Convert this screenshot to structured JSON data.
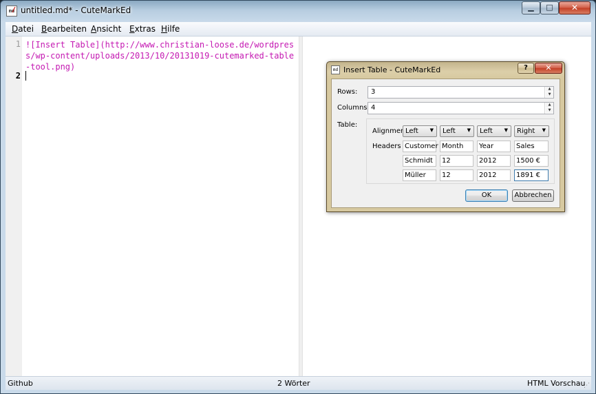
{
  "window": {
    "title": "untitled.md* - CuteMarkEd",
    "app_icon": "md-file-icon",
    "buttons": {
      "minimize": "▁",
      "maximize": "□",
      "close": "✕"
    }
  },
  "menu": [
    {
      "mnemonic": "D",
      "rest": "atei"
    },
    {
      "mnemonic": "B",
      "rest": "earbeiten"
    },
    {
      "mnemonic": "A",
      "rest": "nsicht"
    },
    {
      "mnemonic": "E",
      "rest": "xtras"
    },
    {
      "mnemonic": "H",
      "rest": "ilfe"
    }
  ],
  "editor": {
    "line_numbers": [
      "1",
      "2"
    ],
    "content": "![Insert Table](http://www.christian-loose.de/wordpress/wp-content/uploads/2013/10/20131019-cutemarked-table-tool.png)"
  },
  "status": {
    "left": "Github",
    "center": "2 Wörter",
    "right": "HTML Vorschau"
  },
  "dialog": {
    "title": "Insert Table - CuteMarkEd",
    "help_label": "?",
    "close_label": "✕",
    "rows_label": "Rows:",
    "rows_value": "3",
    "columns_label": "Columns:",
    "columns_value": "4",
    "table_label": "Table:",
    "alignment_label": "Alignment",
    "headers_label": "Headers",
    "alignments": [
      "Left",
      "Left",
      "Left",
      "Right"
    ],
    "headers": [
      "Customer",
      "Month",
      "Year",
      "Sales"
    ],
    "rows": [
      [
        "Schmidt",
        "12",
        "2012",
        "1500 €"
      ],
      [
        "Müller",
        "12",
        "2012",
        "1891 €"
      ]
    ],
    "ok_label": "OK",
    "cancel_label": "Abbrechen"
  }
}
